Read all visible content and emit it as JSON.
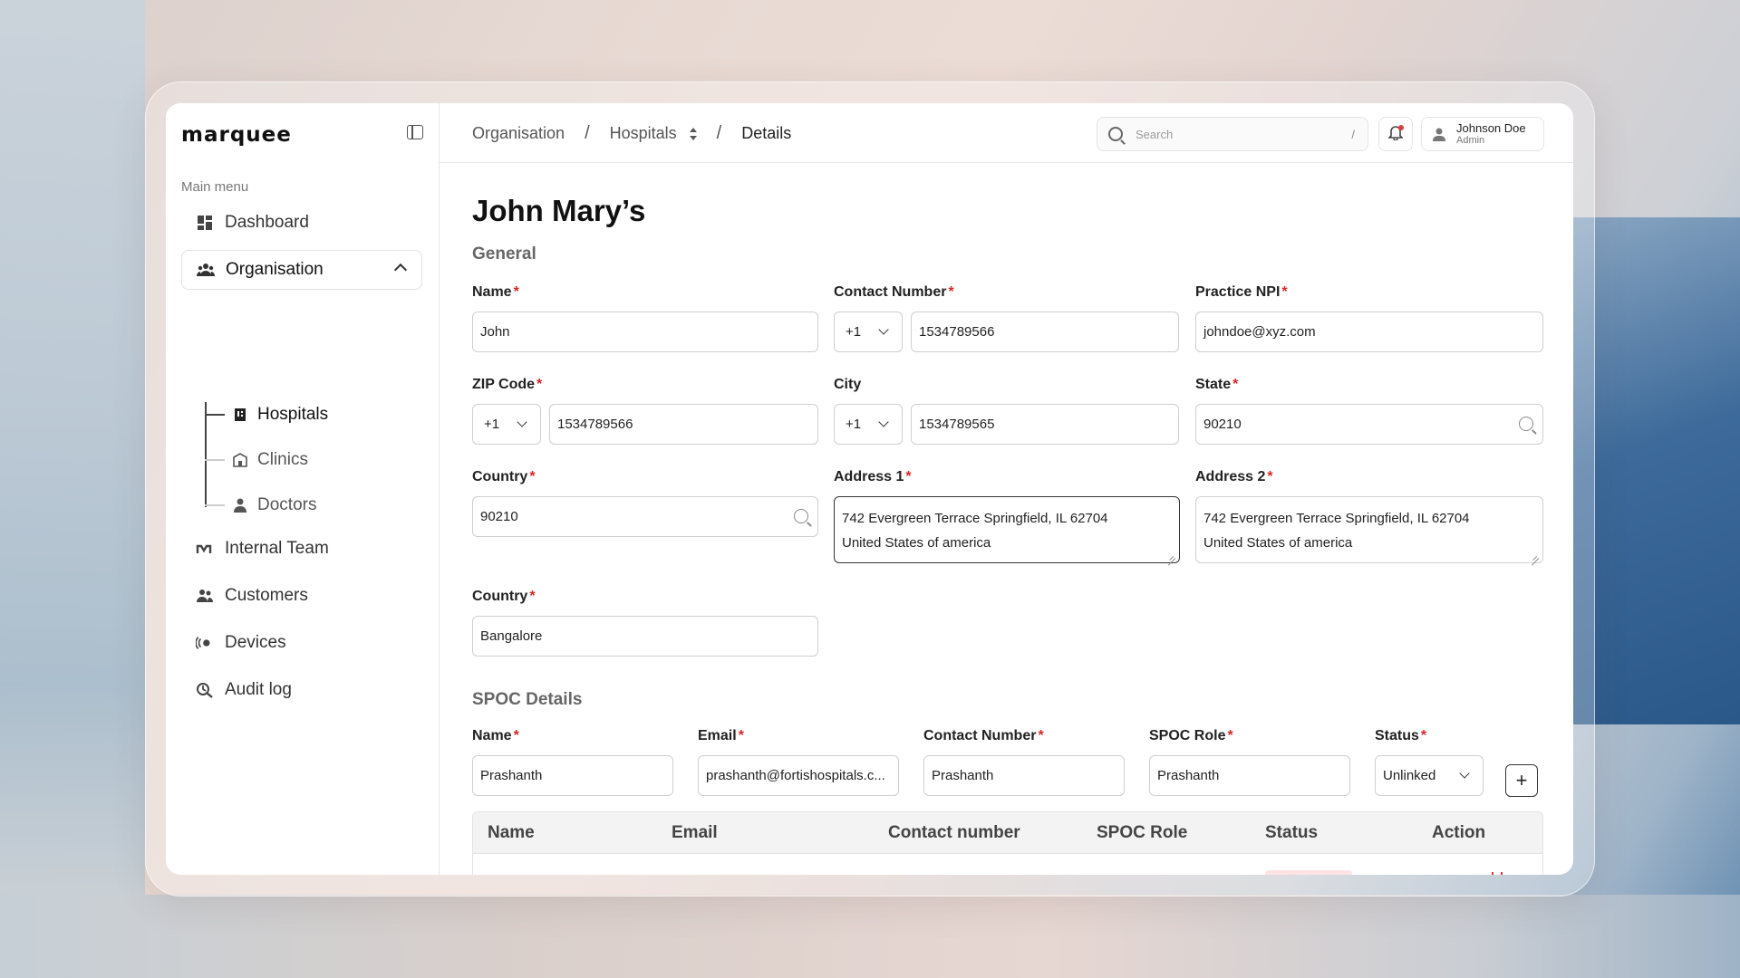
{
  "app": {
    "logo": "marquee"
  },
  "sidebar": {
    "heading": "Main menu",
    "items": [
      {
        "label": "Dashboard"
      },
      {
        "label": "Organisation"
      },
      {
        "label": "Internal Team"
      },
      {
        "label": "Customers"
      },
      {
        "label": "Devices"
      },
      {
        "label": "Audit log"
      }
    ],
    "sub_items": [
      {
        "label": "Hospitals"
      },
      {
        "label": "Clinics"
      },
      {
        "label": "Doctors"
      }
    ]
  },
  "header": {
    "breadcrumb": [
      "Organisation",
      "Hospitals",
      "Details"
    ],
    "search_placeholder": "Search",
    "search_shortcut": "/",
    "user_name": "Johnson Doe",
    "user_role": "Admin"
  },
  "page": {
    "title": "John Mary’s"
  },
  "general": {
    "title": "General",
    "name_label": "Name",
    "name_value": "John",
    "contact_label": "Contact Number",
    "contact_code": "+1",
    "contact_value": "1534789566",
    "npi_label": "Practice NPI",
    "npi_value": "johndoe@xyz.com",
    "zip_label": "ZIP Code",
    "zip_code": "+1",
    "zip_value": "1534789566",
    "city_label": "City",
    "city_code": "+1",
    "city_value": "1534789565",
    "state_label": "State",
    "state_value": "90210",
    "country_label": "Country",
    "country_value": "90210",
    "address1_label": "Address 1",
    "address1_line1": "742 Evergreen Terrace Springfield, IL 62704",
    "address1_line2": "United States of america",
    "address2_label": "Address 2",
    "address2_line1": "742 Evergreen Terrace Springfield, IL 62704",
    "address2_line2": "United States of america",
    "country2_label": "Country",
    "country2_value": "Bangalore"
  },
  "spoc": {
    "title": "SPOC Details",
    "name_label": "Name",
    "name_value": "Prashanth",
    "email_label": "Email",
    "email_value": "prashanth@fortishospitals.c...",
    "contact_label": "Contact Number",
    "contact_value": "Prashanth",
    "role_label": "SPOC Role",
    "role_value": "Prashanth",
    "status_label": "Status",
    "status_value": "Unlinked",
    "table_headers": [
      "Name",
      "Email",
      "Contact number",
      "SPOC  Role",
      "Status",
      "Action"
    ]
  },
  "colors": {
    "required": "#d62828",
    "notification_dot": "#e03b3b"
  },
  "icons": [
    "sidebar-toggle-icon",
    "dashboard-icon",
    "organisation-icon",
    "hospital-icon",
    "clinic-icon",
    "doctor-icon",
    "internal-team-icon",
    "customers-icon",
    "devices-icon",
    "audit-log-icon",
    "search-icon",
    "bell-icon",
    "user-icon",
    "plus-icon",
    "trash-icon"
  ]
}
